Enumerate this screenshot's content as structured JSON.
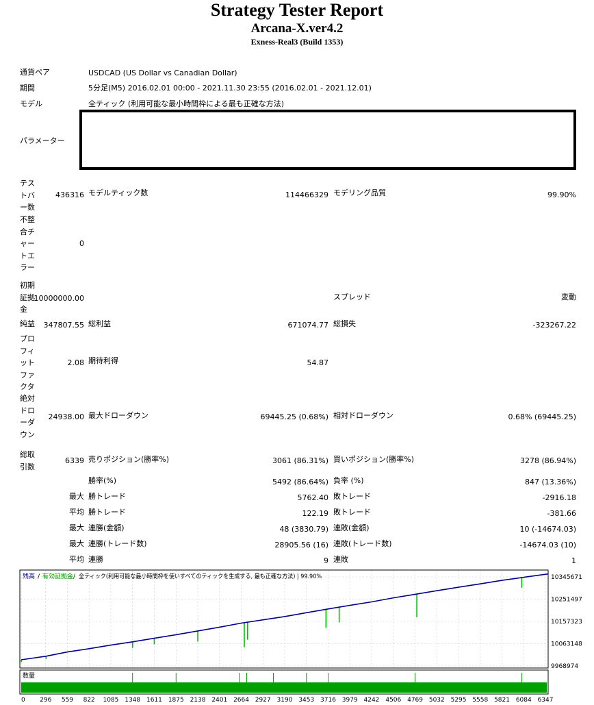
{
  "report": {
    "title": "Strategy Tester Report",
    "ea_name": "Arcana-X.ver4.2",
    "server": "Exness-Real3 (Build 1353)"
  },
  "settings": {
    "symbol_label": "通貨ペア",
    "symbol_value": "USDCAD (US Dollar vs Canadian Dollar)",
    "period_label": "期間",
    "period_value": "5分足(M5) 2016.02.01 00:00 - 2021.11.30 23:55 (2016.02.01 - 2021.12.01)",
    "model_label": "モデル",
    "model_value": "全ティック (利用可能な最小時間枠による最も正確な方法)",
    "params_label": "パラメーター"
  },
  "stats": {
    "bars_label": "テストバー数",
    "bars_value": "436316",
    "ticks_label": "モデルティック数",
    "ticks_value": "114466329",
    "quality_label": "モデリング品質",
    "quality_value": "99.90%",
    "mismatch_label": "不整合チャートエラー",
    "mismatch_value": "0",
    "deposit_label": "初期証拠金",
    "deposit_value": "10000000.00",
    "spread_label": "スプレッド",
    "spread_value": "変動",
    "net_label": "純益",
    "net_value": "347807.55",
    "gross_profit_label": "総利益",
    "gross_profit_value": "671074.77",
    "gross_loss_label": "総損失",
    "gross_loss_value": "-323267.22",
    "pf_label": "プロフィットファクタ",
    "pf_value": "2.08",
    "expected_label": "期待利得",
    "expected_value": "54.87",
    "abs_dd_label": "絶対ドローダウン",
    "abs_dd_value": "24938.00",
    "max_dd_label": "最大ドローダウン",
    "max_dd_value": "69445.25 (0.68%)",
    "rel_dd_label": "相対ドローダウン",
    "rel_dd_value": "0.68% (69445.25)",
    "trades_label": "総取引数",
    "trades_value": "6339",
    "short_label": "売りポジション(勝率%)",
    "short_value": "3061 (86.31%)",
    "long_label": "買いポジション(勝率%)",
    "long_value": "3278 (86.94%)",
    "win_label": "勝率(%)",
    "win_value": "5492 (86.64%)",
    "loss_label": "負率 (%)",
    "loss_value": "847 (13.36%)",
    "lbl_max": "最大",
    "lbl_avg": "平均",
    "largest_win_label": "勝トレード",
    "largest_win_value": "5762.40",
    "largest_loss_label": "敗トレード",
    "largest_loss_value": "-2916.18",
    "avg_win_label": "勝トレード",
    "avg_win_value": "122.19",
    "avg_loss_label": "敗トレード",
    "avg_loss_value": "-381.66",
    "max_cons_win_label": "連勝(金額)",
    "max_cons_win_value": "48 (3830.79)",
    "max_cons_loss_label": "連敗(金額)",
    "max_cons_loss_value": "10 (-14674.03)",
    "max_cons_profit_label": "連勝(トレード数)",
    "max_cons_profit_value": "28905.56 (16)",
    "max_cons_lossamt_label": "連敗(トレード数)",
    "max_cons_lossamt_value": "-14674.03 (10)",
    "avg_cons_win_label": "連勝",
    "avg_cons_win_value": "9",
    "avg_cons_loss_label": "連敗",
    "avg_cons_loss_value": "1"
  },
  "chart_data": {
    "type": "line",
    "legend": {
      "balance": "残高",
      "sep1": " / ",
      "equity": "有効証拠金",
      "sep2": " / ",
      "note": "全ティック(利用可能な最小時間枠を使いすべてのティックを生成する, 最も正確な方法) | 99.90%"
    },
    "volume_label": "数量",
    "y_ticks": [
      10345671,
      10251497,
      10157323,
      10063148,
      9968974
    ],
    "x_ticks": [
      0,
      296,
      559,
      822,
      1085,
      1348,
      1611,
      1875,
      2138,
      2401,
      2664,
      2927,
      3190,
      3453,
      3716,
      3979,
      4242,
      4506,
      4769,
      5032,
      5295,
      5558,
      5821,
      6084,
      6347
    ],
    "ylim": [
      9968974,
      10345671
    ],
    "xlim": [
      0,
      6380
    ],
    "balance_series": {
      "x": [
        0,
        300,
        560,
        822,
        1085,
        1348,
        1611,
        1875,
        2138,
        2401,
        2664,
        2927,
        3190,
        3453,
        3716,
        3979,
        4242,
        4506,
        4769,
        5032,
        5295,
        5558,
        5821,
        6084,
        6380
      ],
      "y": [
        9995000,
        10010000,
        10028000,
        10042000,
        10057000,
        10071000,
        10086000,
        10101000,
        10117000,
        10133000,
        10150000,
        10164000,
        10178000,
        10194000,
        10210000,
        10225000,
        10240000,
        10257000,
        10272000,
        10287000,
        10302000,
        10316000,
        10331000,
        10344000,
        10358000
      ]
    },
    "equity_dips": [
      {
        "x": 0,
        "y": 9985000
      },
      {
        "x": 300,
        "y": 9998000
      },
      {
        "x": 1348,
        "y": 10045000
      },
      {
        "x": 1611,
        "y": 10060000
      },
      {
        "x": 2138,
        "y": 10072000
      },
      {
        "x": 2701,
        "y": 10048000
      },
      {
        "x": 2740,
        "y": 10080000
      },
      {
        "x": 3690,
        "y": 10130000
      },
      {
        "x": 3850,
        "y": 10153000
      },
      {
        "x": 4790,
        "y": 10175000
      },
      {
        "x": 6060,
        "y": 10300000
      }
    ],
    "volume_spikes": [
      1348,
      1875,
      2640,
      2730,
      3053,
      3453,
      3716,
      4769,
      6060
    ]
  }
}
